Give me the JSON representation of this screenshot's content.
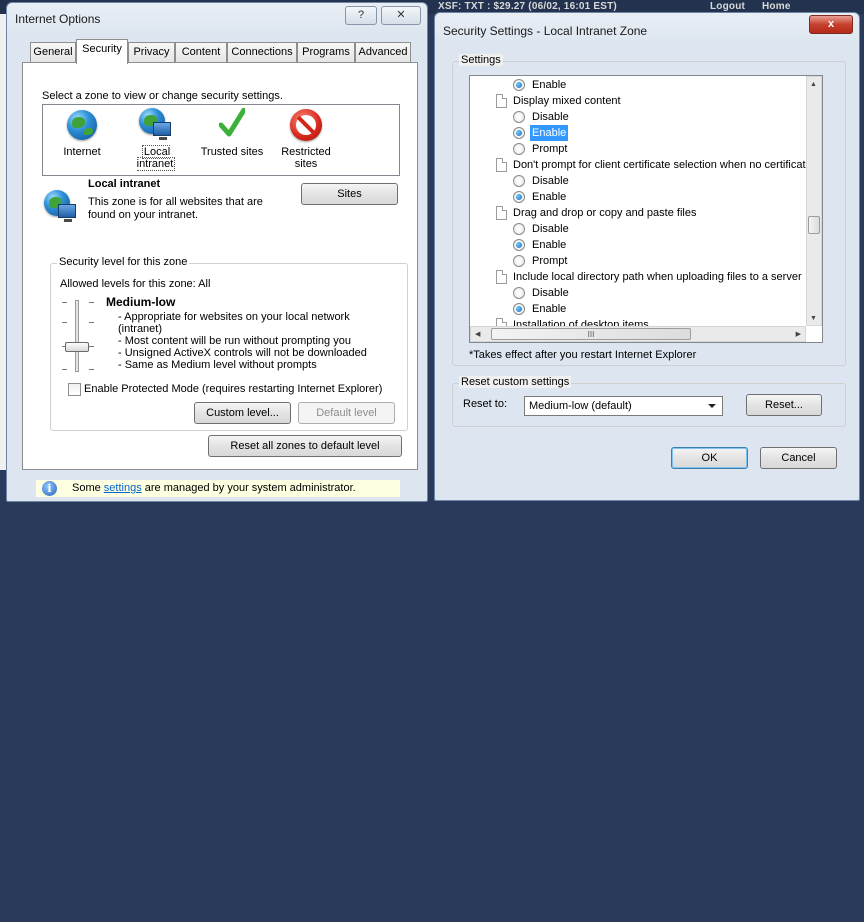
{
  "background": {
    "ticker": "XSF: TXT : $29.27 (06/02, 16:01 EST)",
    "menu_logout": "Logout",
    "menu_home": "Home"
  },
  "internet_options": {
    "title": "Internet Options",
    "help_button": "?",
    "tabs": [
      {
        "label": "General"
      },
      {
        "label": "Security"
      },
      {
        "label": "Privacy"
      },
      {
        "label": "Content"
      },
      {
        "label": "Connections"
      },
      {
        "label": "Programs"
      },
      {
        "label": "Advanced"
      }
    ],
    "active_tab": "Security",
    "zone_prompt": "Select a zone to view or change security settings.",
    "zones": [
      {
        "label": "Internet",
        "icon": "globe-icon"
      },
      {
        "label": "Local intranet",
        "icon": "local-intranet-icon"
      },
      {
        "label": "Trusted sites",
        "icon": "checkmark-icon"
      },
      {
        "label": "Restricted sites",
        "icon": "restricted-icon"
      }
    ],
    "selected_zone": "Local intranet",
    "zone_info": {
      "name": "Local intranet",
      "description": "This zone is for all websites that are found on your intranet.",
      "sites_button": "Sites"
    },
    "security_level": {
      "group_label": "Security level for this zone",
      "allowed": "Allowed levels for this zone: All",
      "level_name": "Medium-low",
      "bullets": [
        "- Appropriate for websites on your local network",
        "(intranet)",
        "- Most content will be run without prompting you",
        "- Unsigned ActiveX controls will not be downloaded",
        "- Same as Medium level without prompts"
      ],
      "protected_mode_label": "Enable Protected Mode (requires restarting Internet Explorer)",
      "protected_mode_checked": false,
      "custom_level_button": "Custom level...",
      "default_level_button": "Default level"
    },
    "reset_all_button": "Reset all zones to default level",
    "info_bar": {
      "prefix": "Some ",
      "link": "settings",
      "suffix": " are managed by your system administrator."
    }
  },
  "security_settings": {
    "title": "Security Settings - Local Intranet Zone",
    "close_label": "x",
    "settings_label": "Settings",
    "items": [
      {
        "kind": "option",
        "label": "Enable",
        "checked": true
      },
      {
        "kind": "setting",
        "label": "Display mixed content"
      },
      {
        "kind": "option",
        "label": "Disable",
        "checked": false
      },
      {
        "kind": "option",
        "label": "Enable",
        "checked": true,
        "highlighted": true
      },
      {
        "kind": "option",
        "label": "Prompt",
        "checked": false
      },
      {
        "kind": "setting",
        "label": "Don't prompt for client certificate selection when no certificat"
      },
      {
        "kind": "option",
        "label": "Disable",
        "checked": false
      },
      {
        "kind": "option",
        "label": "Enable",
        "checked": true
      },
      {
        "kind": "setting",
        "label": "Drag and drop or copy and paste files"
      },
      {
        "kind": "option",
        "label": "Disable",
        "checked": false
      },
      {
        "kind": "option",
        "label": "Enable",
        "checked": true
      },
      {
        "kind": "option",
        "label": "Prompt",
        "checked": false
      },
      {
        "kind": "setting",
        "label": "Include local directory path when uploading files to a server"
      },
      {
        "kind": "option",
        "label": "Disable",
        "checked": false
      },
      {
        "kind": "option",
        "label": "Enable",
        "checked": true
      },
      {
        "kind": "setting",
        "label": "Installation of desktop items"
      }
    ],
    "hscroll_grip": "III",
    "footnote": "*Takes effect after you restart Internet Explorer",
    "reset_group_label": "Reset custom settings",
    "reset_to_label": "Reset to:",
    "reset_to_value": "Medium-low (default)",
    "reset_button": "Reset...",
    "ok_button": "OK",
    "cancel_button": "Cancel"
  }
}
